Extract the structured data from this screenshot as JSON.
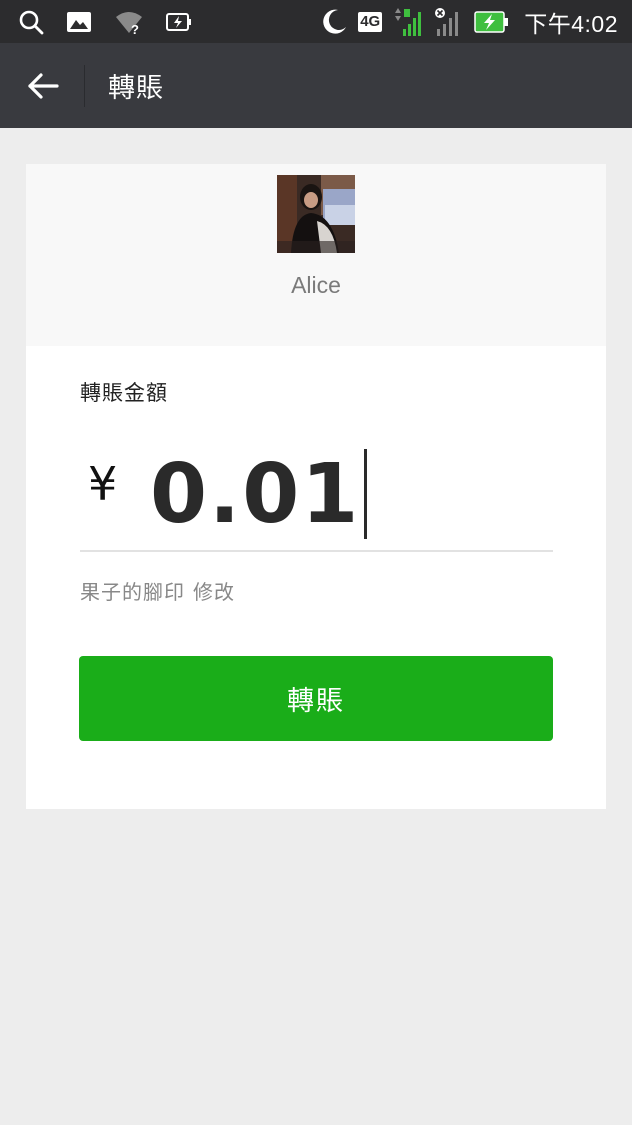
{
  "status_bar": {
    "network_type": "4G",
    "time": "下午4:02",
    "icons": [
      "search-icon",
      "gallery-icon",
      "wifi-question-icon",
      "battery-saver-icon",
      "moon-icon",
      "signal-icon",
      "signal-no-sim-icon",
      "battery-charging-icon"
    ]
  },
  "nav": {
    "title": "轉賬",
    "back_icon": "arrow-left-icon"
  },
  "recipient": {
    "name": "Alice"
  },
  "amount": {
    "label": "轉賬金額",
    "currency": "¥",
    "value": "0.01"
  },
  "remark": {
    "text": "果子的腳印",
    "edit_label": "修改"
  },
  "actions": {
    "transfer_label": "轉賬"
  },
  "colors": {
    "accent_green": "#1aad19",
    "nav_bg": "#393a3f",
    "status_bg": "#2c2c2e",
    "page_bg": "#ededed"
  }
}
